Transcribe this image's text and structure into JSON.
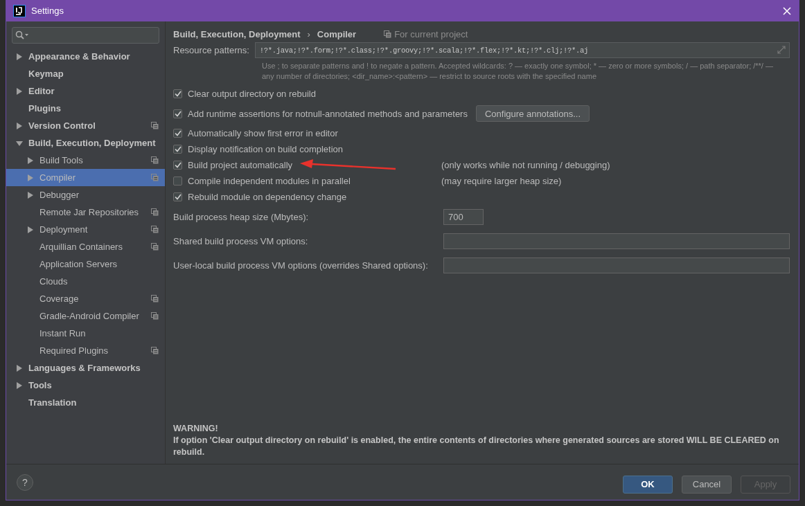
{
  "window": {
    "title": "Settings"
  },
  "sidebar": {
    "items": [
      {
        "label": "Appearance & Behavior",
        "expanded": false,
        "selected": false
      },
      {
        "label": "Keymap",
        "selected": false
      },
      {
        "label": "Editor",
        "expanded": false,
        "selected": false
      },
      {
        "label": "Plugins",
        "selected": false
      },
      {
        "label": "Version Control",
        "expanded": false,
        "project_scoped": true,
        "selected": false
      },
      {
        "label": "Build, Execution, Deployment",
        "expanded": true,
        "selected": false,
        "children": [
          {
            "label": "Build Tools",
            "expanded": false,
            "project_scoped": true,
            "selected": false
          },
          {
            "label": "Compiler",
            "expanded": false,
            "project_scoped": true,
            "selected": true
          },
          {
            "label": "Debugger",
            "expanded": false,
            "selected": false
          },
          {
            "label": "Remote Jar Repositories",
            "project_scoped": true,
            "selected": false
          },
          {
            "label": "Deployment",
            "expanded": false,
            "project_scoped": true,
            "selected": false
          },
          {
            "label": "Arquillian Containers",
            "project_scoped": true,
            "selected": false
          },
          {
            "label": "Application Servers",
            "selected": false
          },
          {
            "label": "Clouds",
            "selected": false
          },
          {
            "label": "Coverage",
            "project_scoped": true,
            "selected": false
          },
          {
            "label": "Gradle-Android Compiler",
            "project_scoped": true,
            "selected": false
          },
          {
            "label": "Instant Run",
            "selected": false
          },
          {
            "label": "Required Plugins",
            "project_scoped": true,
            "selected": false
          }
        ]
      },
      {
        "label": "Languages & Frameworks",
        "expanded": false,
        "selected": false
      },
      {
        "label": "Tools",
        "expanded": false,
        "selected": false
      },
      {
        "label": "Translation",
        "selected": false
      }
    ]
  },
  "content": {
    "breadcrumb": [
      "Build, Execution, Deployment",
      "›",
      "Compiler"
    ],
    "scope": "For current project",
    "resource_patterns": {
      "label": "Resource patterns:",
      "value": "!?*.java;!?*.form;!?*.class;!?*.groovy;!?*.scala;!?*.flex;!?*.kt;!?*.clj;!?*.aj"
    },
    "hint": "Use ; to separate patterns and ! to negate a pattern. Accepted wildcards: ? — exactly one symbol; * — zero or more symbols; / — path separator; /**/ — any number of directories; <dir_name>:<pattern> — restrict to source roots with the specified name",
    "options": [
      {
        "label": "Clear output directory on rebuild",
        "checked": true
      },
      {
        "label": "Add runtime assertions for notnull-annotated methods and parameters",
        "checked": true,
        "button": "Configure annotations..."
      },
      {
        "label": "Automatically show first error in editor",
        "checked": true
      },
      {
        "label": "Display notification on build completion",
        "checked": true
      },
      {
        "label": "Build project automatically",
        "checked": true,
        "note": "(only works while not running / debugging)",
        "annotated": true
      },
      {
        "label": "Compile independent modules in parallel",
        "checked": false,
        "note": "(may require larger heap size)"
      },
      {
        "label": "Rebuild module on dependency change",
        "checked": true
      }
    ],
    "fields": [
      {
        "label": "Build process heap size (Mbytes):",
        "value": "700",
        "kind": "short"
      },
      {
        "label": "Shared build process VM options:",
        "kind": "wide"
      },
      {
        "label": "User-local build process VM options (overrides Shared options):",
        "kind": "wide"
      }
    ],
    "warning": {
      "title": "WARNING!",
      "text": "If option 'Clear output directory on rebuild' is enabled, the entire contents of directories where generated sources are stored WILL BE CLEARED on rebuild."
    }
  },
  "footer": {
    "help": "?",
    "buttons": [
      {
        "label": "OK",
        "kind": "default",
        "disabled": false
      },
      {
        "label": "Cancel",
        "kind": "normal",
        "disabled": false
      },
      {
        "label": "Apply",
        "kind": "normal",
        "disabled": true
      }
    ]
  }
}
